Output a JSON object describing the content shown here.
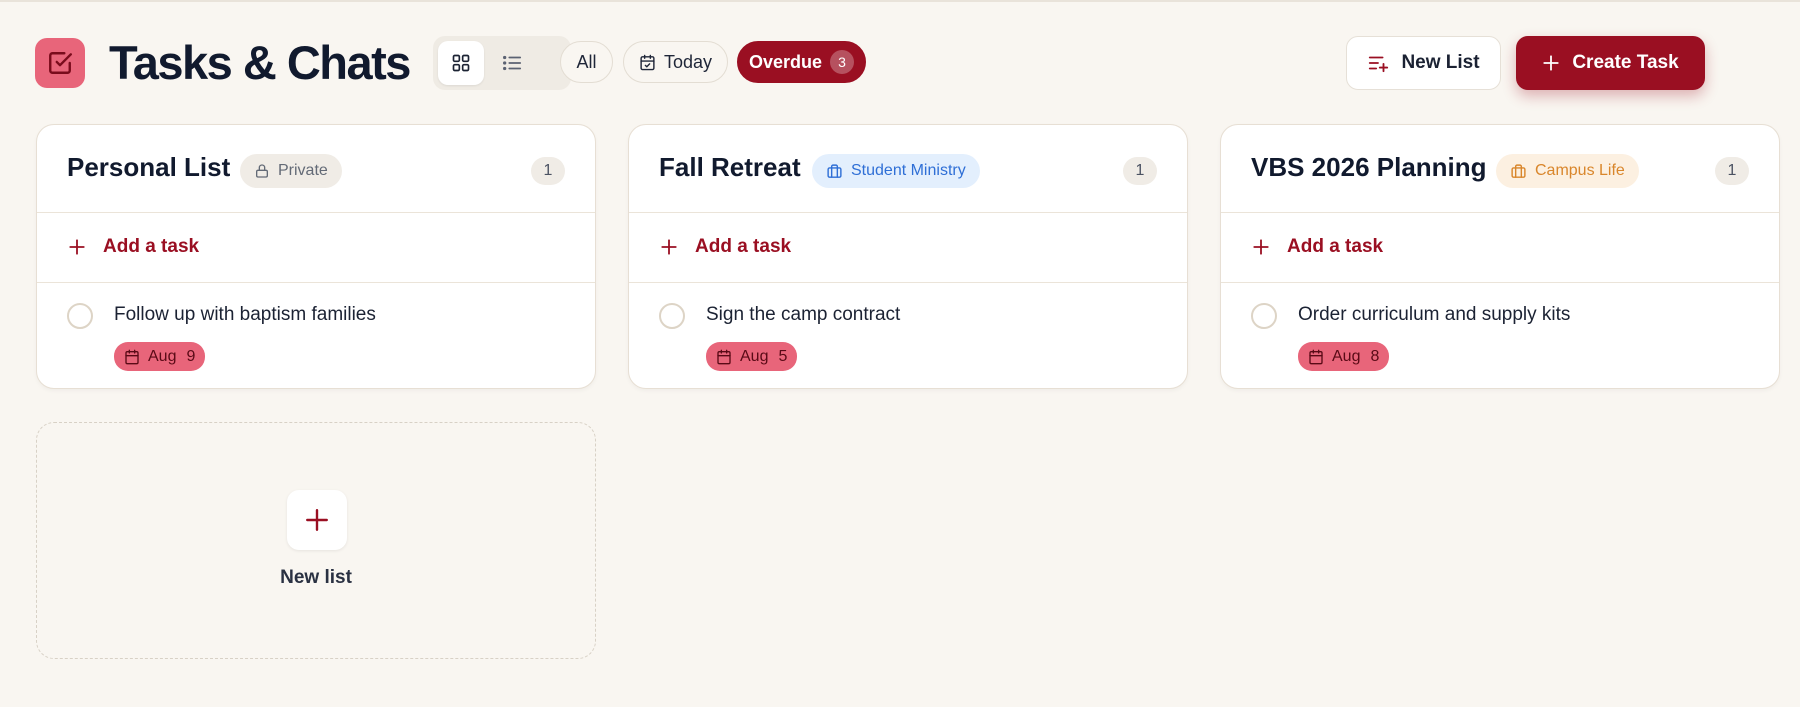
{
  "header": {
    "title": "Tasks & Chats",
    "filters": {
      "all": "All",
      "today": "Today",
      "overdue": "Overdue",
      "overdue_count": "3"
    },
    "new_list_label": "New List",
    "create_task_label": "Create Task"
  },
  "lists": [
    {
      "title": "Personal List",
      "badge": "Private",
      "badge_icon": "lock-icon",
      "count": "1",
      "add_label": "Add a task",
      "task": {
        "text": "Follow up with baptism families",
        "due_month": "Aug",
        "due_day": "9"
      }
    },
    {
      "title": "Fall Retreat",
      "badge": "Student Ministry",
      "badge_icon": "briefcase-icon",
      "count": "1",
      "add_label": "Add a task",
      "task": {
        "text": "Sign the camp contract",
        "due_month": "Aug",
        "due_day": "5"
      }
    },
    {
      "title": "VBS 2026 Planning",
      "badge": "Campus Life",
      "badge_icon": "briefcase-icon",
      "count": "1",
      "add_label": "Add a task",
      "task": {
        "text": "Order curriculum and supply kits",
        "due_month": "Aug",
        "due_day": "8"
      }
    }
  ],
  "new_list_card": {
    "label": "New list"
  },
  "colors": {
    "accent": "#9a0f22",
    "logo": "#e8657a",
    "due_badge": "#e8657a",
    "background": "#f9f6f1"
  }
}
